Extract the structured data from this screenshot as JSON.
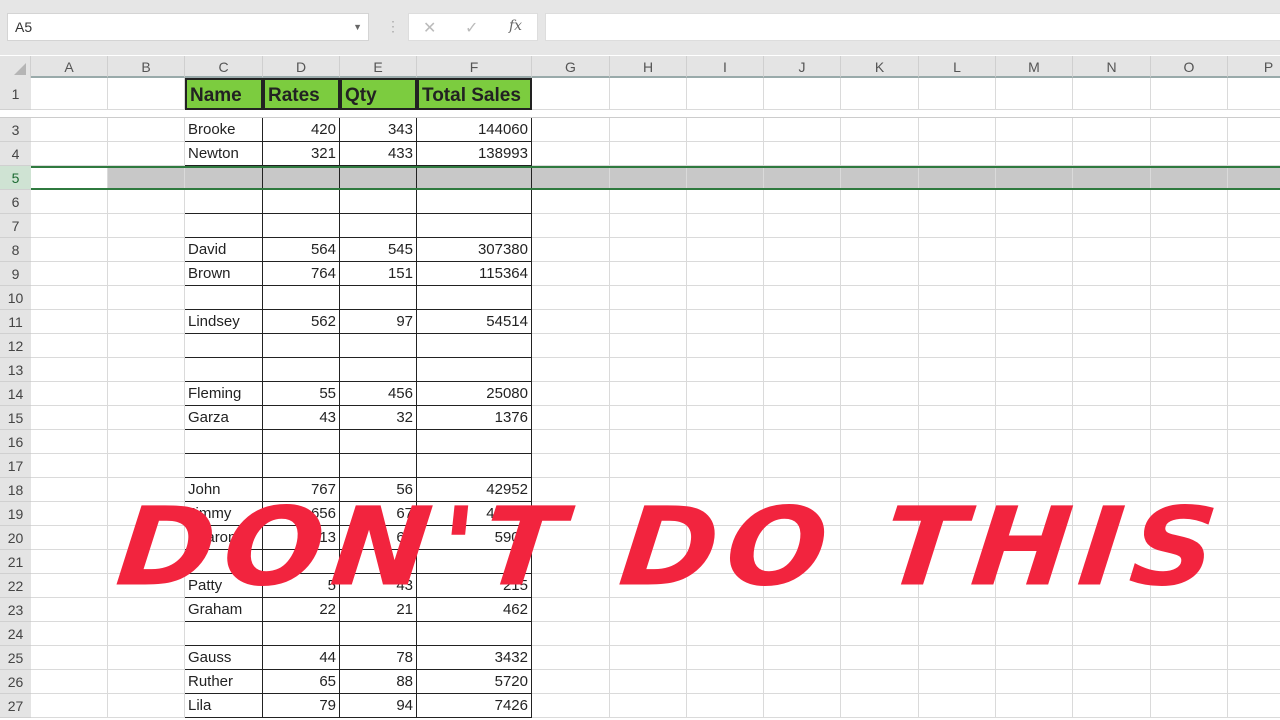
{
  "formula_bar": {
    "name_box": "A5",
    "cancel_icon": "x-icon",
    "enter_icon": "check-icon",
    "fx_label": "fx",
    "formula": ""
  },
  "columns": [
    "A",
    "B",
    "C",
    "D",
    "E",
    "F",
    "G",
    "H",
    "I",
    "J",
    "K",
    "L",
    "M",
    "N",
    "O",
    "P"
  ],
  "header_row": {
    "row": "1",
    "cells": [
      "Name",
      "Rates",
      "Qty",
      "Total Sales"
    ],
    "fill": "#7ccc3f"
  },
  "rows": [
    {
      "row": "3",
      "cells": [
        "Brooke",
        "420",
        "343",
        "144060"
      ]
    },
    {
      "row": "4",
      "cells": [
        "Newton",
        "321",
        "433",
        "138993"
      ]
    },
    {
      "row": "5",
      "cells": [
        "",
        "",
        "",
        ""
      ],
      "selected": true
    },
    {
      "row": "6",
      "cells": [
        "",
        "",
        "",
        ""
      ]
    },
    {
      "row": "7",
      "cells": [
        "",
        "",
        "",
        ""
      ]
    },
    {
      "row": "8",
      "cells": [
        "David",
        "564",
        "545",
        "307380"
      ]
    },
    {
      "row": "9",
      "cells": [
        "Brown",
        "764",
        "151",
        "115364"
      ]
    },
    {
      "row": "10",
      "cells": [
        "",
        "",
        "",
        ""
      ]
    },
    {
      "row": "11",
      "cells": [
        "Lindsey",
        "562",
        "97",
        "54514"
      ]
    },
    {
      "row": "12",
      "cells": [
        "",
        "",
        "",
        ""
      ]
    },
    {
      "row": "13",
      "cells": [
        "",
        "",
        "",
        ""
      ]
    },
    {
      "row": "14",
      "cells": [
        "Fleming",
        "55",
        "456",
        "25080"
      ]
    },
    {
      "row": "15",
      "cells": [
        "Garza",
        "43",
        "32",
        "1376"
      ]
    },
    {
      "row": "16",
      "cells": [
        "",
        "",
        "",
        ""
      ]
    },
    {
      "row": "17",
      "cells": [
        "",
        "",
        "",
        ""
      ]
    },
    {
      "row": "18",
      "cells": [
        "John",
        "767",
        "56",
        "42952"
      ]
    },
    {
      "row": "19",
      "cells": [
        "Jimmy",
        "656",
        "67",
        "43952"
      ]
    },
    {
      "row": "20",
      "cells": [
        "Sharon",
        "13",
        "65",
        "5900"
      ]
    },
    {
      "row": "21",
      "cells": [
        "",
        "",
        "",
        ""
      ]
    },
    {
      "row": "22",
      "cells": [
        "Patty",
        "5",
        "43",
        "215"
      ]
    },
    {
      "row": "23",
      "cells": [
        "Graham",
        "22",
        "21",
        "462"
      ]
    },
    {
      "row": "24",
      "cells": [
        "",
        "",
        "",
        ""
      ]
    },
    {
      "row": "25",
      "cells": [
        "Gauss",
        "44",
        "78",
        "3432"
      ]
    },
    {
      "row": "26",
      "cells": [
        "Ruther",
        "65",
        "88",
        "5720"
      ]
    },
    {
      "row": "27",
      "cells": [
        "Lila",
        "79",
        "94",
        "7426"
      ]
    }
  ],
  "overlay_text": "DON'T DO THIS",
  "colors": {
    "overlay": "#f2243e",
    "selection_border": "#2f7a3f",
    "selected_fill": "#c8c8c8"
  }
}
